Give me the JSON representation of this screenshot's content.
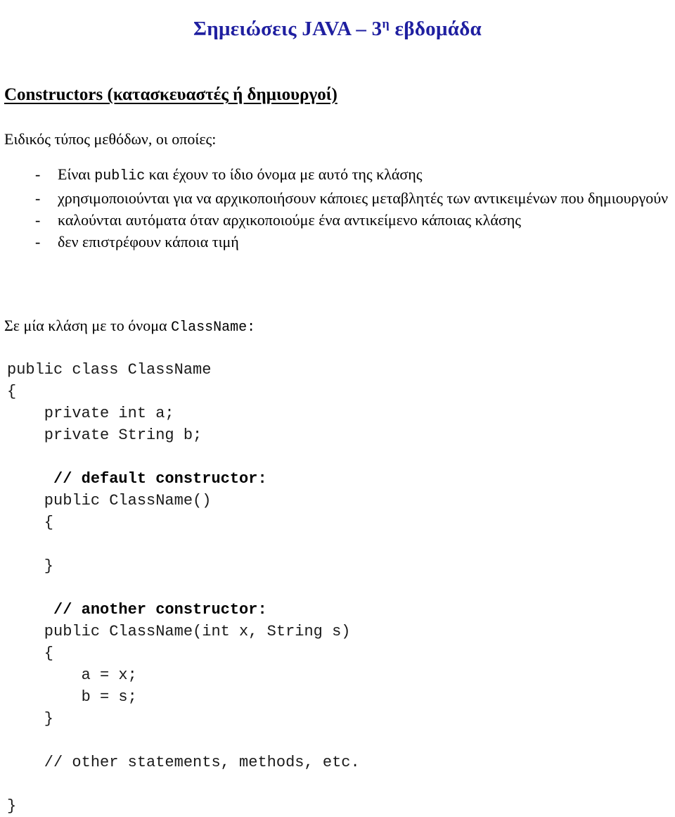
{
  "document": {
    "title_prefix": "Σημειώσεις JAVA – 3",
    "title_superscript": "η",
    "title_suffix": " εβδομάδα",
    "section_heading": "Constructors (κατασκευαστές ή δημιουργοί)",
    "intro_line": "Ειδικός τύπος μεθόδων, οι οποίες:"
  },
  "bullets": {
    "marker": "-",
    "items": [
      {
        "pre": "Είναι ",
        "mono": "public",
        "post": " και έχουν το ίδιο όνομα με αυτό της κλάσης",
        "justified": false
      },
      {
        "pre": "",
        "mono": "",
        "post": "χρησιμοποιούνται για να αρχικοποιήσουν κάποιες μεταβλητές των αντικειμένων που δημιουργούν",
        "justified": true
      },
      {
        "pre": "",
        "mono": "",
        "post": "καλούνται αυτόματα όταν αρχικοποιούμε ένα αντικείμενο κάποιας κλάσης",
        "justified": false
      },
      {
        "pre": "",
        "mono": "",
        "post": "δεν επιστρέφουν κάποια τιμή",
        "justified": false
      }
    ]
  },
  "classname_line": {
    "pre": "Σε μία κλάση με το όνομα ",
    "mono": "ClassName:"
  },
  "code": {
    "lines": [
      {
        "text": "public class ClassName",
        "bold": false
      },
      {
        "text": "{",
        "bold": false
      },
      {
        "text": "    private int a;",
        "bold": false
      },
      {
        "text": "    private String b;",
        "bold": false
      },
      {
        "text": "",
        "bold": false
      },
      {
        "text": "     // default constructor:",
        "bold": true
      },
      {
        "text": "    public ClassName()",
        "bold": false
      },
      {
        "text": "    {",
        "bold": false
      },
      {
        "text": "",
        "bold": false
      },
      {
        "text": "    }",
        "bold": false
      },
      {
        "text": "",
        "bold": false
      },
      {
        "text": "     // another constructor:",
        "bold": true
      },
      {
        "text": "    public ClassName(int x, String s)",
        "bold": false
      },
      {
        "text": "    {",
        "bold": false
      },
      {
        "text": "        a = x;",
        "bold": false
      },
      {
        "text": "        b = s;",
        "bold": false
      },
      {
        "text": "    }",
        "bold": false
      },
      {
        "text": "",
        "bold": false
      },
      {
        "text": "    // other statements, methods, etc.",
        "bold": false
      },
      {
        "text": "",
        "bold": false
      },
      {
        "text": "}",
        "bold": false
      }
    ]
  },
  "colors": {
    "title": "#1f1fa0",
    "text": "#000000",
    "code": "#1a1a1a",
    "background": "#ffffff"
  }
}
